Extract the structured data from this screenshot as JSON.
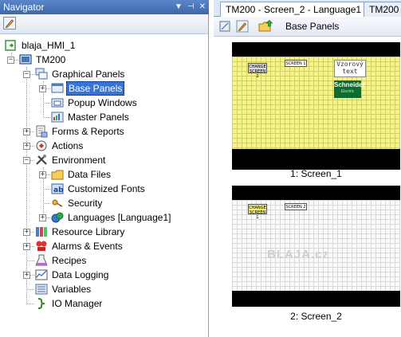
{
  "navigator": {
    "title": "Navigator",
    "title_buttons": [
      "▼",
      "⊣",
      "✕"
    ],
    "tree": [
      {
        "id": "root",
        "label": "blaja_HMI_1",
        "icon": "project-icon"
      },
      {
        "id": "tm200",
        "label": "TM200",
        "icon": "target-icon"
      },
      {
        "id": "graphical",
        "label": "Graphical Panels",
        "icon": "graphical-panels-icon"
      },
      {
        "id": "base",
        "label": "Base Panels",
        "icon": "base-panels-icon",
        "selected": true
      },
      {
        "id": "popup",
        "label": "Popup Windows",
        "icon": "popup-windows-icon"
      },
      {
        "id": "master",
        "label": "Master Panels",
        "icon": "master-panels-icon"
      },
      {
        "id": "forms",
        "label": "Forms & Reports",
        "icon": "forms-reports-icon"
      },
      {
        "id": "actions",
        "label": "Actions",
        "icon": "actions-icon"
      },
      {
        "id": "environment",
        "label": "Environment",
        "icon": "environment-icon"
      },
      {
        "id": "datafiles",
        "label": "Data Files",
        "icon": "data-files-icon"
      },
      {
        "id": "fonts",
        "label": "Customized Fonts",
        "icon": "customized-fonts-icon"
      },
      {
        "id": "security",
        "label": "Security",
        "icon": "security-icon"
      },
      {
        "id": "languages",
        "label": "Languages [Language1]",
        "icon": "languages-icon"
      },
      {
        "id": "resource",
        "label": "Resource Library",
        "icon": "resource-library-icon"
      },
      {
        "id": "alarms",
        "label": "Alarms & Events",
        "icon": "alarms-events-icon"
      },
      {
        "id": "recipes",
        "label": "Recipes",
        "icon": "recipes-icon"
      },
      {
        "id": "logging",
        "label": "Data Logging",
        "icon": "data-logging-icon"
      },
      {
        "id": "variables",
        "label": "Variables",
        "icon": "variables-icon"
      },
      {
        "id": "io",
        "label": "IO Manager",
        "icon": "io-manager-icon"
      }
    ]
  },
  "editor": {
    "tabs": [
      "TM200 - Screen_2 - Language1",
      "TM200"
    ],
    "toolbar_title": "Base Panels",
    "screens": [
      {
        "caption": "1: Screen_1",
        "change_button": "CHANGE SCREEN 2",
        "screen_label": "SCREEN 1",
        "sample_text": "Vzorový text",
        "logo_text": "Schneider",
        "logo_subtext": "Electric"
      },
      {
        "caption": "2: Screen_2",
        "change_button": "CHANGE SCREEN 1",
        "screen_label": "SCREEN 2",
        "watermark": "BLAJA.cz"
      }
    ]
  },
  "colors": {
    "selection": "#3874d1",
    "title_bar": "#4a77bd",
    "screen1_bg": "#f6f38a",
    "screen2_bg": "#fbfbfb",
    "logo_bg": "#0d6b2e"
  }
}
